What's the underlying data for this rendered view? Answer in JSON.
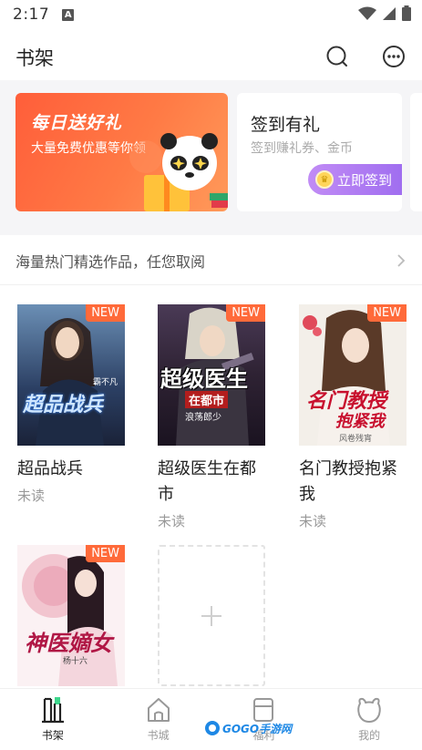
{
  "status_bar": {
    "time": "2:17",
    "notification_letter": "A"
  },
  "header": {
    "title": "书架",
    "search_icon": "search-icon",
    "more_icon": "more-icon"
  },
  "banners": {
    "gift": {
      "title": "每日送好礼",
      "subtitle": "大量免费优惠等你领",
      "accent": "#ff6a3a"
    },
    "checkin": {
      "title": "签到有礼",
      "subtitle": "签到赚礼券、金币",
      "button": "立即签到",
      "accent": "#a874f2"
    }
  },
  "recommend": {
    "text": "海量热门精选作品，任您取阅"
  },
  "books": [
    {
      "title": "超品战兵",
      "status": "未读",
      "badge": "NEW",
      "cover_text": "超品战兵",
      "cover_author": "霸不凡"
    },
    {
      "title": "超级医生在都市",
      "status": "未读",
      "badge": "NEW",
      "cover_text": "超级医生",
      "cover_sub": "在都市",
      "cover_author": "浪荡郎少"
    },
    {
      "title": "名门教授抱紧我",
      "status": "未读",
      "badge": "NEW",
      "cover_text": "名门教授",
      "cover_sub": "抱紧我",
      "cover_author": "风卷残宵"
    },
    {
      "title": "",
      "status": "",
      "badge": "NEW",
      "cover_text": "神医嫡女",
      "cover_author": "杨十六"
    }
  ],
  "bottom_nav": [
    {
      "label": "书架",
      "icon": "bookshelf-icon",
      "active": true
    },
    {
      "label": "书城",
      "icon": "bookstore-icon",
      "active": false
    },
    {
      "label": "福利",
      "icon": "welfare-icon",
      "active": false
    },
    {
      "label": "我的",
      "icon": "profile-icon",
      "active": false
    }
  ],
  "watermark": {
    "text": "GOGO手游网"
  }
}
